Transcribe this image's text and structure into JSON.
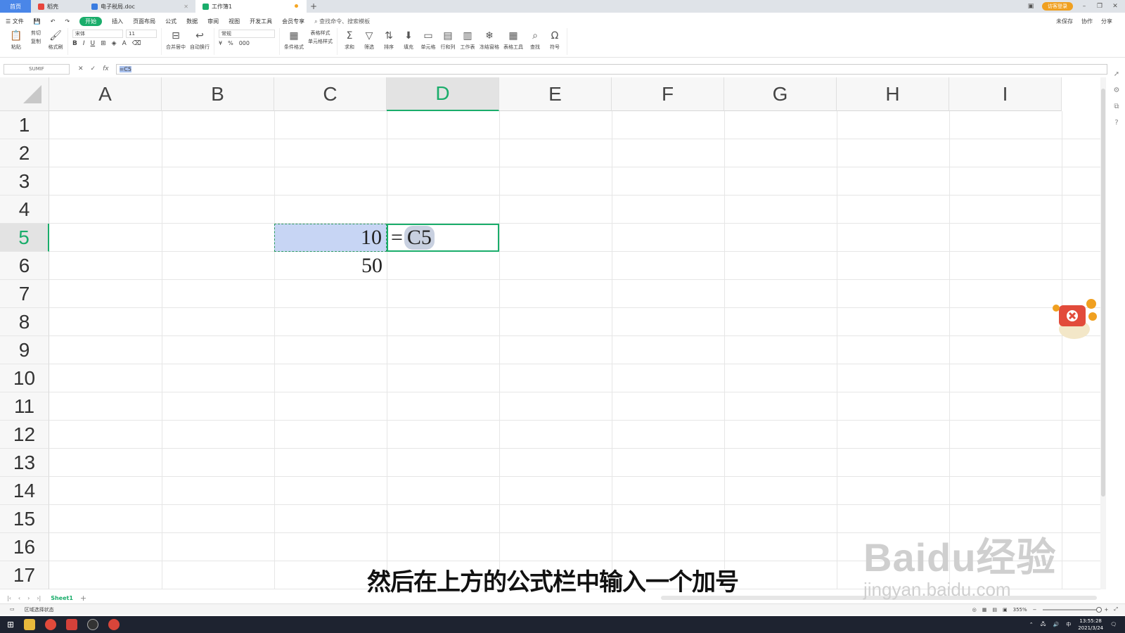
{
  "tabs": {
    "home": "首页",
    "docer": "稻壳",
    "doc": "电子税局.doc",
    "workbook": "工作簿1"
  },
  "titlebar": {
    "login": "访客登录"
  },
  "menu": {
    "file": "文件",
    "items": [
      "开始",
      "插入",
      "页面布局",
      "公式",
      "数据",
      "审阅",
      "视图",
      "开发工具",
      "会员专享"
    ],
    "search": "查找命令、搜索模板",
    "right": [
      "未保存",
      "协作",
      "分享"
    ]
  },
  "ribbon": {
    "paste": "粘贴",
    "cut": "剪切",
    "copy": "复制",
    "format_painter": "格式刷",
    "font_name": "宋体",
    "font_size": "11",
    "merge": "合并居中",
    "wrap": "自动换行",
    "number_format": "常规",
    "conditional": "条件格式",
    "table_style": "表格样式",
    "cell_style": "单元格样式",
    "sum": "求和",
    "filter": "筛选",
    "sort": "排序",
    "fill": "填充",
    "cell": "单元格",
    "rowcol": "行和列",
    "sheet": "工作表",
    "freeze": "冻结窗格",
    "table_tools": "表格工具",
    "find": "查找",
    "symbol": "符号"
  },
  "formula_bar": {
    "name_box": "SUMIF",
    "cancel": "✕",
    "confirm": "✓",
    "fx": "fx",
    "formula": "=C5"
  },
  "grid": {
    "columns": [
      "A",
      "B",
      "C",
      "D",
      "E",
      "F",
      "G",
      "H",
      "I"
    ],
    "rows": [
      "1",
      "2",
      "3",
      "4",
      "5",
      "6",
      "7",
      "8",
      "9",
      "10",
      "11",
      "12",
      "13",
      "14",
      "15",
      "16",
      "17"
    ],
    "selected_column": "D",
    "selected_row": "5",
    "cells": {
      "C5": "10",
      "C6": "50",
      "D5_eq": "=",
      "D5_ref": "C5"
    }
  },
  "sheets": {
    "active": "Sheet1",
    "add": "+"
  },
  "statusbar": {
    "mode": "区域选择状态",
    "zoom": "355%"
  },
  "taskbar": {
    "time": "13:55:28",
    "date": "2021/3/24",
    "ime": "中"
  },
  "subtitle": "然后在上方的公式栏中输入一个加号",
  "watermark": {
    "title": "Baidu经验",
    "url": "jingyan.baidu.com"
  },
  "colors": {
    "accent": "#1aad6b",
    "selection_fill": "#c7d5f4",
    "home_tab": "#4a86e8"
  }
}
